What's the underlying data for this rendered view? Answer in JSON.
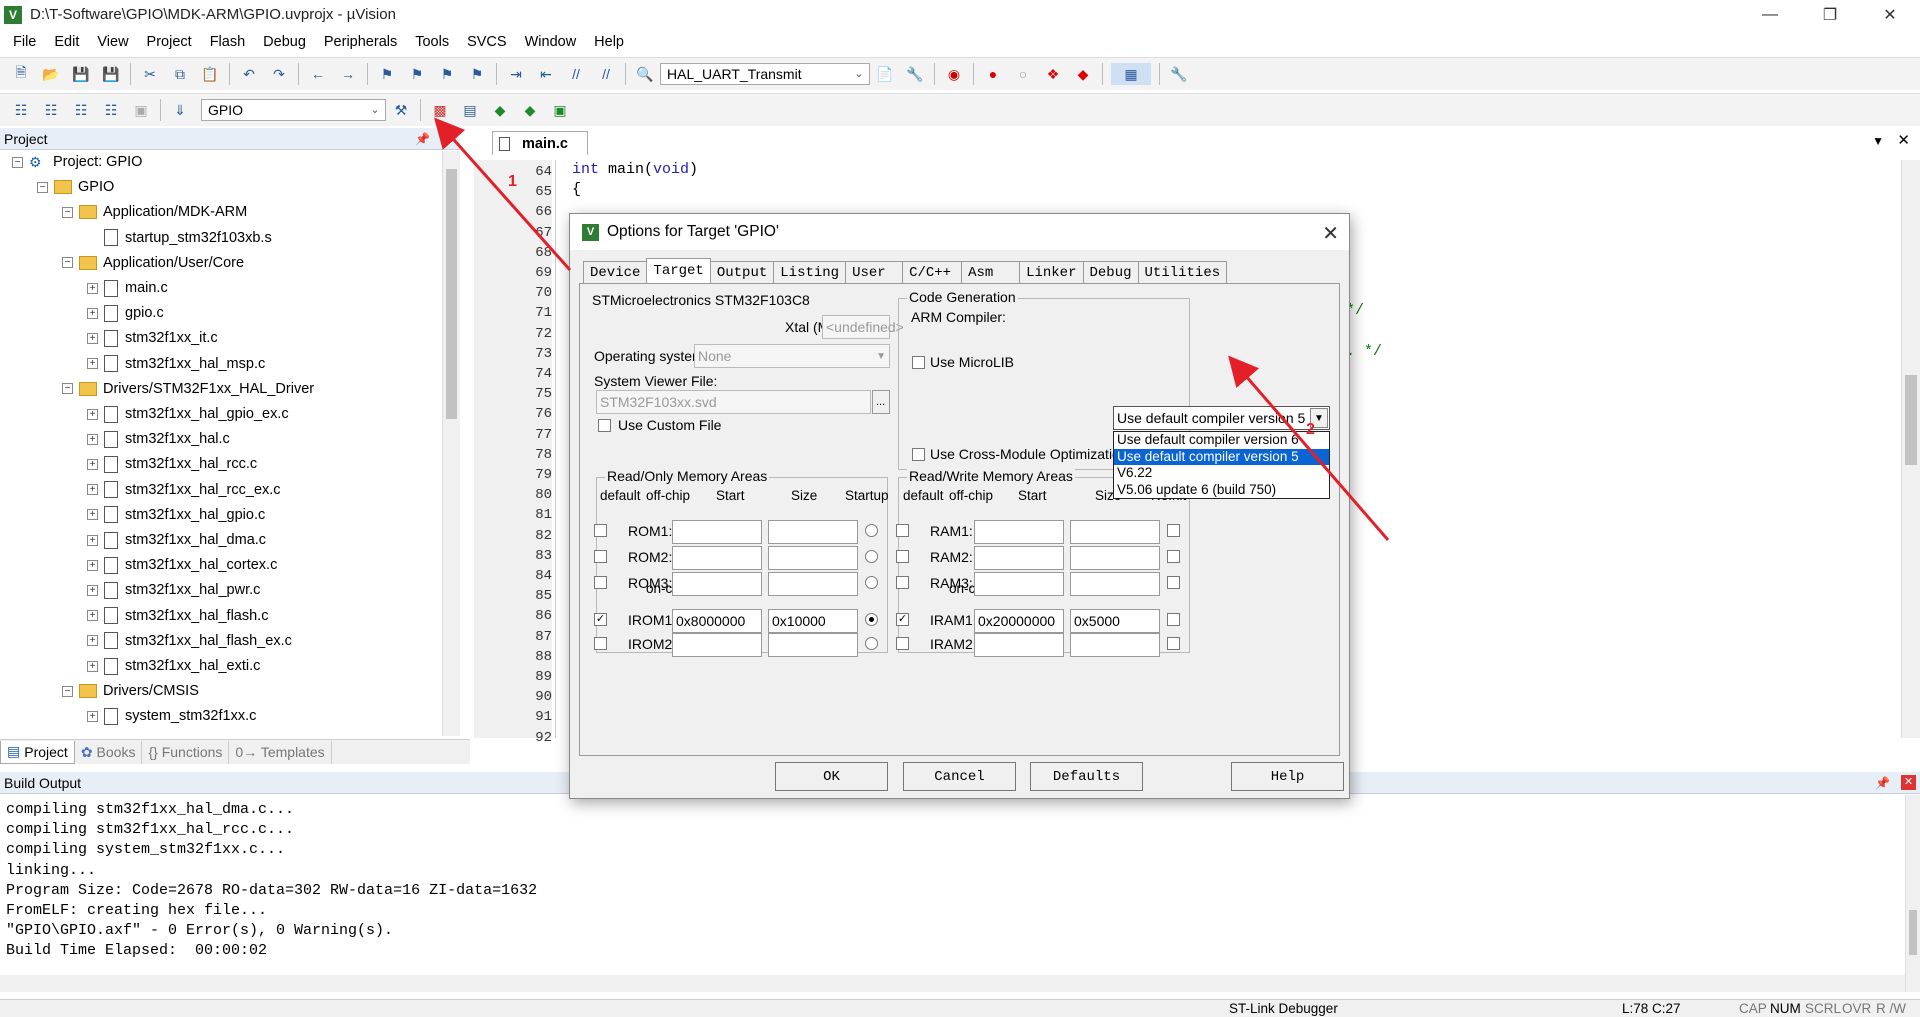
{
  "window": {
    "title": "D:\\T-Software\\GPIO\\MDK-ARM\\GPIO.uvprojx - µVision"
  },
  "menu": [
    "File",
    "Edit",
    "View",
    "Project",
    "Flash",
    "Debug",
    "Peripherals",
    "Tools",
    "SVCS",
    "Window",
    "Help"
  ],
  "toolbar": {
    "function_combo": "HAL_UART_Transmit",
    "target_combo": "GPIO"
  },
  "project_panel": {
    "title": "Project",
    "items": [
      {
        "label": "Project: GPIO",
        "level": 0,
        "kind": "project",
        "tog": "−"
      },
      {
        "label": "GPIO",
        "level": 1,
        "kind": "folder",
        "tog": "−"
      },
      {
        "label": "Application/MDK-ARM",
        "level": 2,
        "kind": "folder",
        "tog": "−"
      },
      {
        "label": "startup_stm32f103xb.s",
        "level": 3,
        "kind": "file",
        "tog": ""
      },
      {
        "label": "Application/User/Core",
        "level": 2,
        "kind": "folder",
        "tog": "−"
      },
      {
        "label": "main.c",
        "level": 3,
        "kind": "file",
        "tog": "+"
      },
      {
        "label": "gpio.c",
        "level": 3,
        "kind": "file",
        "tog": "+"
      },
      {
        "label": "stm32f1xx_it.c",
        "level": 3,
        "kind": "file",
        "tog": "+"
      },
      {
        "label": "stm32f1xx_hal_msp.c",
        "level": 3,
        "kind": "file",
        "tog": "+"
      },
      {
        "label": "Drivers/STM32F1xx_HAL_Driver",
        "level": 2,
        "kind": "folder",
        "tog": "−"
      },
      {
        "label": "stm32f1xx_hal_gpio_ex.c",
        "level": 3,
        "kind": "file",
        "tog": "+"
      },
      {
        "label": "stm32f1xx_hal.c",
        "level": 3,
        "kind": "file",
        "tog": "+"
      },
      {
        "label": "stm32f1xx_hal_rcc.c",
        "level": 3,
        "kind": "file",
        "tog": "+"
      },
      {
        "label": "stm32f1xx_hal_rcc_ex.c",
        "level": 3,
        "kind": "file",
        "tog": "+"
      },
      {
        "label": "stm32f1xx_hal_gpio.c",
        "level": 3,
        "kind": "file",
        "tog": "+"
      },
      {
        "label": "stm32f1xx_hal_dma.c",
        "level": 3,
        "kind": "file",
        "tog": "+"
      },
      {
        "label": "stm32f1xx_hal_cortex.c",
        "level": 3,
        "kind": "file",
        "tog": "+"
      },
      {
        "label": "stm32f1xx_hal_pwr.c",
        "level": 3,
        "kind": "file",
        "tog": "+"
      },
      {
        "label": "stm32f1xx_hal_flash.c",
        "level": 3,
        "kind": "file",
        "tog": "+"
      },
      {
        "label": "stm32f1xx_hal_flash_ex.c",
        "level": 3,
        "kind": "file",
        "tog": "+"
      },
      {
        "label": "stm32f1xx_hal_exti.c",
        "level": 3,
        "kind": "file",
        "tog": "+"
      },
      {
        "label": "Drivers/CMSIS",
        "level": 2,
        "kind": "folder",
        "tog": "−"
      },
      {
        "label": "system_stm32f1xx.c",
        "level": 3,
        "kind": "file",
        "tog": "+"
      }
    ],
    "tabs": [
      "Project",
      "Books",
      "{} Functions",
      "0→ Templates"
    ]
  },
  "editor": {
    "tab": "main.c",
    "line_numbers": [
      "64",
      "65",
      "66",
      "67",
      "68",
      "69",
      "70",
      "71",
      "72",
      "73",
      "74",
      "75",
      "76",
      "77",
      "78",
      "79",
      "80",
      "81",
      "82",
      "83",
      "84",
      "85",
      "86",
      "87",
      "88",
      "89",
      "90",
      "91",
      "92"
    ],
    "visible_code": [
      {
        "text": "int main(void)",
        "row": 0
      },
      {
        "text": "{",
        "row": 1
      }
    ],
    "trailing_comments": [
      {
        "text": "*/",
        "row": 7
      },
      {
        "text": ". */",
        "row": 9
      }
    ]
  },
  "dialog": {
    "title": "Options for Target 'GPIO'",
    "tabs": [
      "Device",
      "Target",
      "Output",
      "Listing",
      "User",
      "C/C++",
      "Asm",
      "Linker",
      "Debug",
      "Utilities"
    ],
    "active_tab": "Target",
    "device": "STMicroelectronics STM32F103C8",
    "xtal_label": "Xtal (MHz):",
    "xtal_value": "<undefined>",
    "os_label": "Operating system:",
    "os_value": "None",
    "svd_label": "System Viewer File:",
    "svd_value": "STM32F103xx.svd",
    "use_custom_file": "Use Custom File",
    "code_gen": "Code Generation",
    "arm_compiler_label": "ARM Compiler:",
    "arm_compiler_value": "Use default compiler version 5",
    "compiler_options": [
      "Use default compiler version 6",
      "Use default compiler version 5",
      "V6.22",
      "V5.06 update 6 (build 750)"
    ],
    "use_microlib": "Use MicroLIB",
    "cross_module": "Use Cross-Module Optimization",
    "ro_group": "Read/Only Memory Areas",
    "rw_group": "Read/Write Memory Areas",
    "ro_headers": [
      "default",
      "off-chip",
      "Start",
      "Size",
      "Startup"
    ],
    "rw_headers": [
      "default",
      "off-chip",
      "Start",
      "Size",
      "NoInit"
    ],
    "on_chip": "on-chip",
    "ro_rows": [
      {
        "name": "ROM1:",
        "start": "",
        "size": ""
      },
      {
        "name": "ROM2:",
        "start": "",
        "size": ""
      },
      {
        "name": "ROM3:",
        "start": "",
        "size": ""
      },
      {
        "name": "IROM1:",
        "start": "0x8000000",
        "size": "0x10000"
      },
      {
        "name": "IROM2:",
        "start": "",
        "size": ""
      }
    ],
    "rw_rows": [
      {
        "name": "RAM1:",
        "start": "",
        "size": ""
      },
      {
        "name": "RAM2:",
        "start": "",
        "size": ""
      },
      {
        "name": "RAM3:",
        "start": "",
        "size": ""
      },
      {
        "name": "IRAM1:",
        "start": "0x20000000",
        "size": "0x5000"
      },
      {
        "name": "IRAM2:",
        "start": "",
        "size": ""
      }
    ],
    "buttons": {
      "ok": "OK",
      "cancel": "Cancel",
      "defaults": "Defaults",
      "help": "Help"
    },
    "more_button": "..."
  },
  "annotations": {
    "one": "1",
    "two": "2",
    "color": "#e3202a"
  },
  "build_output": {
    "title": "Build Output",
    "lines": [
      "compiling stm32f1xx_hal_dma.c...",
      "compiling stm32f1xx_hal_rcc.c...",
      "compiling system_stm32f1xx.c...",
      "linking...",
      "Program Size: Code=2678 RO-data=302 RW-data=16 ZI-data=1632",
      "FromELF: creating hex file...",
      "\"GPIO\\GPIO.axf\" - 0 Error(s), 0 Warning(s).",
      "Build Time Elapsed:  00:00:02"
    ]
  },
  "status": {
    "debugger": "ST-Link Debugger",
    "position": "L:78 C:27",
    "cap": "CAP",
    "num": "NUM",
    "scrl": "SCRL",
    "ovr": "OVR",
    "rw": "R /W"
  }
}
